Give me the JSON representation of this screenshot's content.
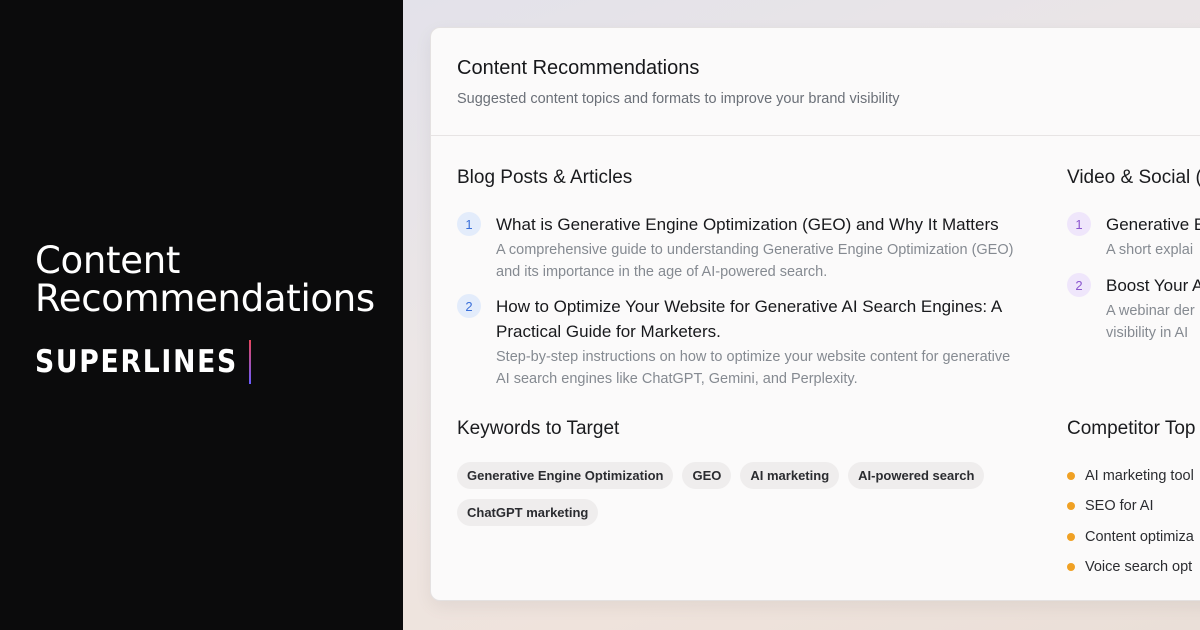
{
  "hero": {
    "title_line1": "Content",
    "title_line2": "Recommendations",
    "brand": "SUPERLINES"
  },
  "card": {
    "title": "Content Recommendations",
    "subtitle": "Suggested content topics and formats to improve your brand visibility"
  },
  "blog": {
    "heading": "Blog Posts & Articles",
    "items": [
      {
        "number": "1",
        "title": "What is Generative Engine Optimization (GEO) and Why It Matters",
        "desc": "A comprehensive guide to understanding Generative Engine Optimization (GEO) and its importance in the age of AI-powered search."
      },
      {
        "number": "2",
        "title": "How to Optimize Your Website for Generative AI Search Engines: A Practical Guide for Marketers.",
        "desc": "Step-by-step instructions on how to optimize your website content for generative AI search engines like ChatGPT, Gemini, and Perplexity."
      }
    ]
  },
  "video": {
    "heading": "Video & Social (",
    "items": [
      {
        "number": "1",
        "title": "Generative E",
        "desc": "A short explai"
      },
      {
        "number": "2",
        "title": "Boost Your A",
        "desc_line1": "A webinar der",
        "desc_line2": "visibility in AI"
      }
    ]
  },
  "keywords": {
    "heading": "Keywords to Target",
    "tags": [
      "Generative Engine Optimization",
      "GEO",
      "AI marketing",
      "AI-powered search",
      "ChatGPT marketing"
    ]
  },
  "competitor": {
    "heading": "Competitor Top",
    "items": [
      "AI marketing tool",
      "SEO for AI",
      "Content optimiza",
      "Voice search opt"
    ]
  },
  "colors": {
    "left_bg": "#0b0b0c",
    "blue_badge": "#3a6fd9",
    "purple_badge": "#8a55cf",
    "bullet_orange": "#f0a124"
  }
}
